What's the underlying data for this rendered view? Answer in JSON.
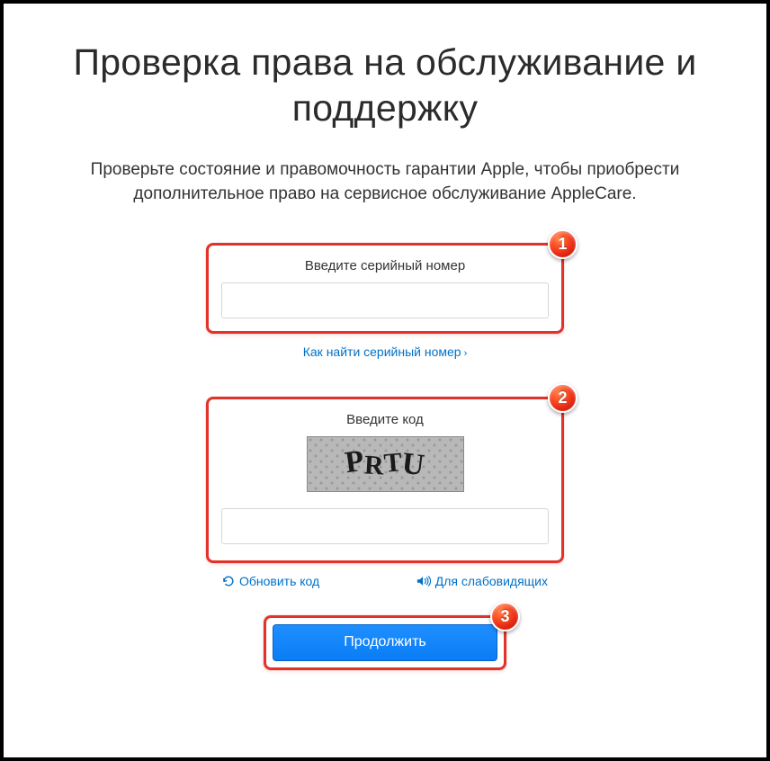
{
  "header": {
    "title": "Проверка права на обслуживание и поддержку",
    "subtitle": "Проверьте состояние и правомочность гарантии Apple, чтобы приобрести дополнительное право на сервисное обслуживание AppleCare."
  },
  "serial": {
    "label": "Введите серийный номер",
    "value": "",
    "help_link": "Как найти серийный номер",
    "badge": "1"
  },
  "captcha": {
    "label": "Введите код",
    "image_text": "PRTU",
    "value": "",
    "refresh_label": "Обновить код",
    "audio_label": "Для слабовидящих",
    "badge": "2"
  },
  "submit": {
    "label": "Продолжить",
    "badge": "3"
  },
  "colors": {
    "callout_border": "#e2332a",
    "link": "#0070c9",
    "button": "#0a7df5"
  }
}
